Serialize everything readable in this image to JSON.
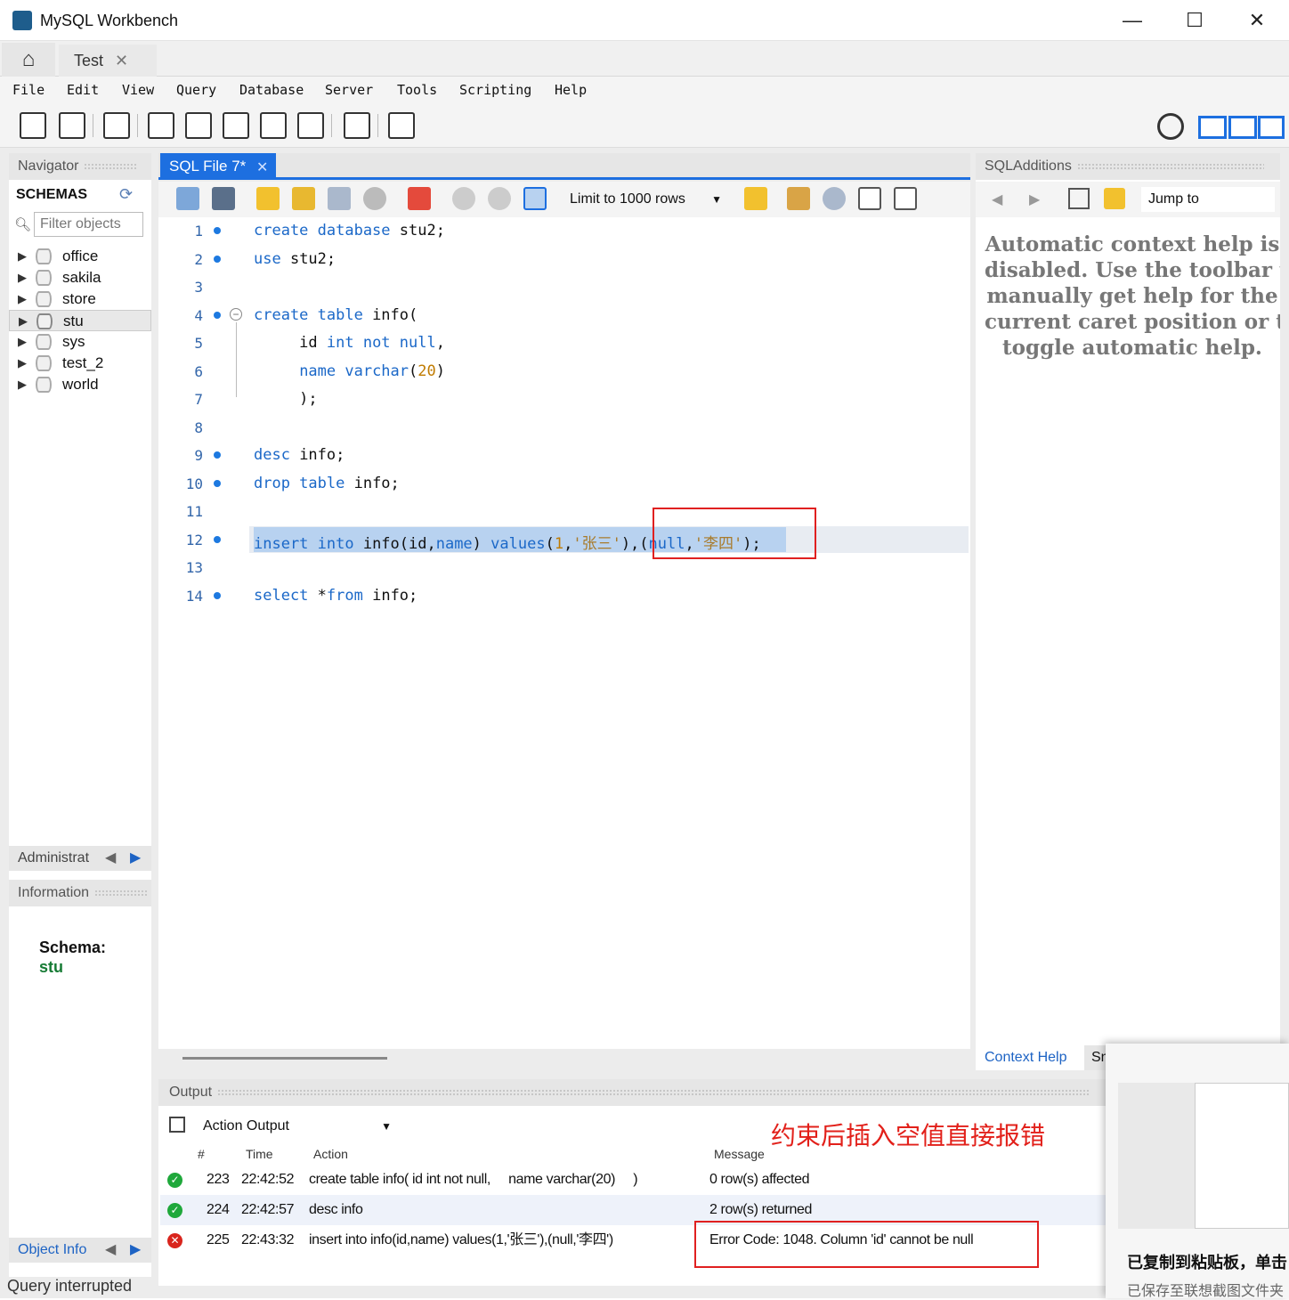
{
  "window": {
    "title": "MySQL Workbench",
    "minimize": "—",
    "maximize": "☐",
    "close": "✕"
  },
  "tabs": {
    "home_icon": "home-icon",
    "connection_tab": "Test",
    "close": "✕"
  },
  "menu": [
    "File",
    "Edit",
    "View",
    "Query",
    "Database",
    "Server",
    "Tools",
    "Scripting",
    "Help"
  ],
  "navigator": {
    "title": "Navigator",
    "schemas_label": "SCHEMAS",
    "filter_placeholder": "Filter objects",
    "schemas": [
      "office",
      "sakila",
      "store",
      "stu",
      "sys",
      "test_2",
      "world"
    ],
    "selected": "stu",
    "admin_tab": "Administrat",
    "info_title": "Information",
    "schema_label": "Schema:",
    "schema_value": "stu",
    "object_info_tab": "Object Info"
  },
  "editor": {
    "tab_label": "SQL File 7*",
    "limit_label": "Limit to 1000 rows",
    "line_numbers": [
      "1",
      "2",
      "3",
      "4",
      "5",
      "6",
      "7",
      "8",
      "9",
      "10",
      "11",
      "12",
      "13",
      "14"
    ]
  },
  "sql_additions": {
    "title": "SQLAdditions",
    "jump_to": "Jump to",
    "help_lines": [
      "Automatic context help is",
      "disabled. Use the toolbar t",
      "manually get help for the",
      "current caret position or to",
      "toggle automatic help."
    ],
    "context_help_tab": "Context Help",
    "snippets_tab": "Sn"
  },
  "output": {
    "title": "Output",
    "selector": "Action Output",
    "annotation": "约束后插入空值直接报错",
    "columns": [
      "#",
      "Time",
      "Action",
      "Message"
    ],
    "rows": [
      {
        "num": "223",
        "time": "22:42:52",
        "action": "create table info( id int not null,     name varchar(20)     )",
        "message": "0 row(s) affected",
        "status": "ok"
      },
      {
        "num": "224",
        "time": "22:42:57",
        "action": "desc info",
        "message": "2 row(s) returned",
        "status": "ok"
      },
      {
        "num": "225",
        "time": "22:43:32",
        "action": "insert into info(id,name) values(1,'张三'),(null,'李四')",
        "message": "Error Code: 1048. Column 'id' cannot be null",
        "status": "error"
      }
    ]
  },
  "status_bar": "Query interrupted",
  "popup": {
    "title": "已复制到粘贴板，单击",
    "subtitle": "已保存至联想截图文件夹"
  },
  "colors": {
    "accent": "#1d6fe0",
    "keyword": "#1b68c8",
    "annotation": "#e2201a",
    "ok": "#1fa83b",
    "error": "#d9251d"
  }
}
